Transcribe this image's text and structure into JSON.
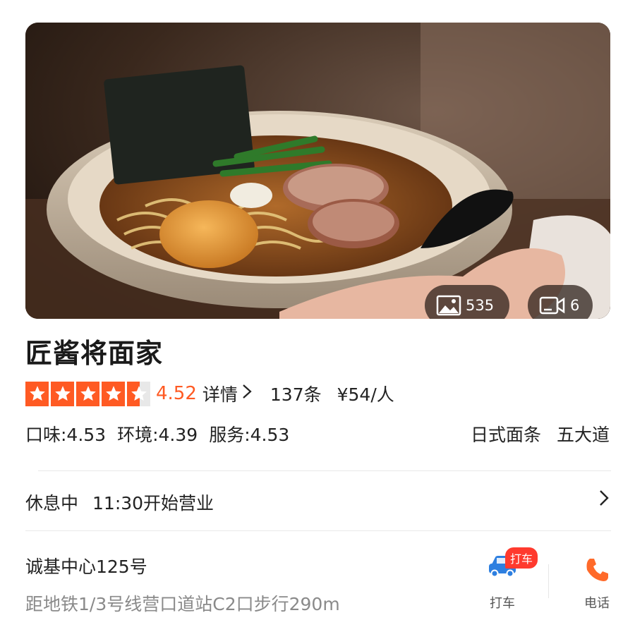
{
  "hero": {
    "photo_count": "535",
    "video_count": "6"
  },
  "shop": {
    "name": "匠酱将面家",
    "rating": "4.52",
    "rating_value": 4.52,
    "details_label": "详情",
    "review_count": "137条",
    "price_per_person": "¥54/人"
  },
  "sub_scores": {
    "taste": "口味:4.53",
    "environment": "环境:4.39",
    "service": "服务:4.53"
  },
  "tags": {
    "cuisine": "日式面条",
    "district": "五大道"
  },
  "hours": {
    "status": "休息中",
    "opening": "11:30开始营业"
  },
  "location": {
    "address": "诚基中心125号",
    "distance": "距地铁1/3号线营口道站C2口步行290m"
  },
  "actions": {
    "taxi_badge": "打车",
    "taxi_label": "打车",
    "phone_label": "电话"
  },
  "colors": {
    "accent": "#ff5a23",
    "badge": "#ff3a2e",
    "taxi_icon": "#2d7fe0",
    "phone_icon": "#ff6a2a",
    "muted_text": "#8a8a8a"
  }
}
